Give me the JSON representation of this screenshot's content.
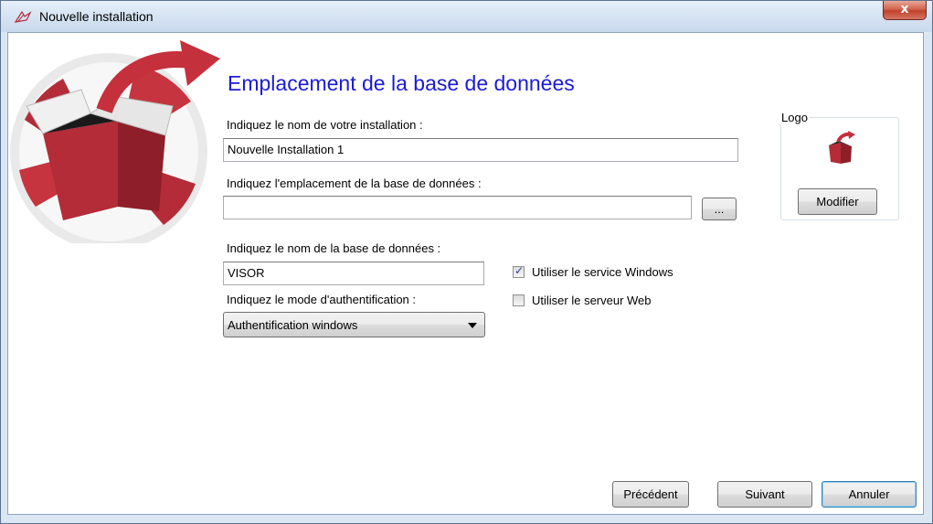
{
  "window": {
    "title": "Nouvelle installation",
    "close_label": "x"
  },
  "page": {
    "heading": "Emplacement de la base de données"
  },
  "install_name": {
    "label": "Indiquez le nom de votre installation :",
    "value": "Nouvelle Installation 1"
  },
  "db_location": {
    "label": "Indiquez l'emplacement de la base de données :",
    "value": "",
    "browse_label": "..."
  },
  "db_name": {
    "label": "Indiquez le nom de la base de données :",
    "value": "VISOR"
  },
  "auth_mode": {
    "label": "Indiquez le mode d'authentification :",
    "selected": "Authentification windows"
  },
  "options": {
    "windows_service": {
      "label": "Utiliser le service Windows",
      "checked": true,
      "mark": "✓"
    },
    "web_server": {
      "label": "Utiliser le serveur Web",
      "checked": false
    }
  },
  "logo_group": {
    "legend": "Logo",
    "modify_label": "Modifier"
  },
  "footer": {
    "previous_label": "Précédent",
    "next_label": "Suivant",
    "cancel_label": "Annuler"
  },
  "colors": {
    "heading": "#1b1bd6",
    "box_red": "#b32c38",
    "arrow_red": "#c4303c"
  },
  "icons": {
    "app": "install-box-icon",
    "hero": "install-box-illustration",
    "logo": "logo-box-icon",
    "close": "close-icon",
    "dropdown": "chevron-down-icon"
  }
}
